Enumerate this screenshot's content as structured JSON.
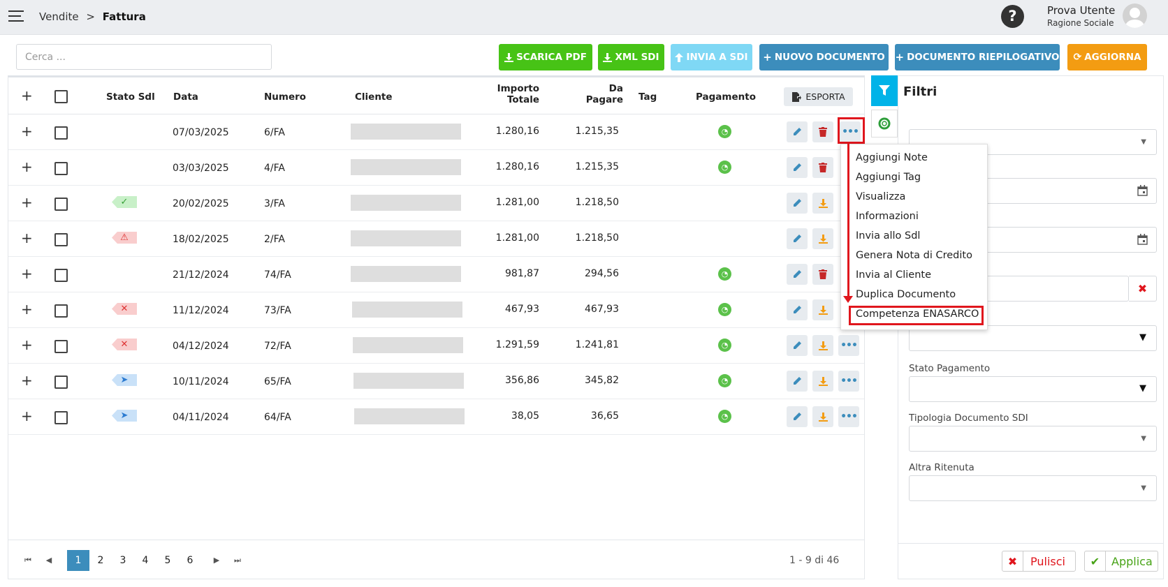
{
  "header": {
    "breadcrumb": [
      "Vendite",
      "Fattura"
    ],
    "breadcrumb_sep": ">",
    "help_icon": "?",
    "user_name": "Prova Utente",
    "user_sub": "Ragione Sociale"
  },
  "search": {
    "placeholder": "Cerca ..."
  },
  "toolbar": {
    "scarica_pdf": "SCARICA PDF",
    "xml_sdi": "XML SDI",
    "invia_sdi": "INVIA A SDI",
    "nuovo_documento": "NUOVO DOCUMENTO",
    "documento_riepilogativo": "DOCUMENTO RIEPILOGATIVO",
    "aggiorna": "AGGIORNA"
  },
  "table": {
    "headers": {
      "stato": "Stato Sdl",
      "data": "Data",
      "numero": "Numero",
      "cliente": "Cliente",
      "importo_1": "Importo",
      "importo_2": "Totale",
      "dapagare_1": "Da",
      "dapagare_2": "Pagare",
      "tag": "Tag",
      "pagamento": "Pagamento",
      "esporta": "ESPORTA"
    },
    "rows": [
      {
        "data": "07/03/2025",
        "numero": "6/FA",
        "importo": "1.280,16",
        "dapagare": "1.215,35"
      },
      {
        "data": "03/03/2025",
        "numero": "4/FA",
        "importo": "1.280,16",
        "dapagare": "1.215,35"
      },
      {
        "data": "20/02/2025",
        "numero": "3/FA",
        "importo": "1.281,00",
        "dapagare": "1.218,50"
      },
      {
        "data": "18/02/2025",
        "numero": "2/FA",
        "importo": "1.281,00",
        "dapagare": "1.218,50"
      },
      {
        "data": "21/12/2024",
        "numero": "74/FA",
        "importo": "981,87",
        "dapagare": "294,56"
      },
      {
        "data": "11/12/2024",
        "numero": "73/FA",
        "importo": "467,93",
        "dapagare": "467,93"
      },
      {
        "data": "04/12/2024",
        "numero": "72/FA",
        "importo": "1.291,59",
        "dapagare": "1.241,81"
      },
      {
        "data": "10/11/2024",
        "numero": "65/FA",
        "importo": "356,86",
        "dapagare": "345,82"
      },
      {
        "data": "04/11/2024",
        "numero": "64/FA",
        "importo": "38,05",
        "dapagare": "36,65"
      }
    ]
  },
  "dropdown": {
    "items": [
      "Aggiungi Note",
      "Aggiungi Tag",
      "Visualizza",
      "Informazioni",
      "Invia allo Sdl",
      "Genera Nota di Credito",
      "Invia al Cliente",
      "Duplica Documento",
      "Competenza ENASARCO"
    ]
  },
  "pagination": {
    "pages": [
      "1",
      "2",
      "3",
      "4",
      "5",
      "6"
    ],
    "info": "1 - 9 di 46"
  },
  "filters": {
    "title": "Filtri",
    "stato_pagamento": "Stato Pagamento",
    "tipologia": "Tipologia Documento SDI",
    "altra_ritenuta": "Altra Ritenuta",
    "pulisci": "Pulisci",
    "applica": "Applica"
  },
  "colors": {
    "green": "#47c316",
    "blue": "#3c8dbc",
    "orange": "#f39c12",
    "light_blue": "#7fd8f5",
    "highlight_red": "#e0161d"
  }
}
